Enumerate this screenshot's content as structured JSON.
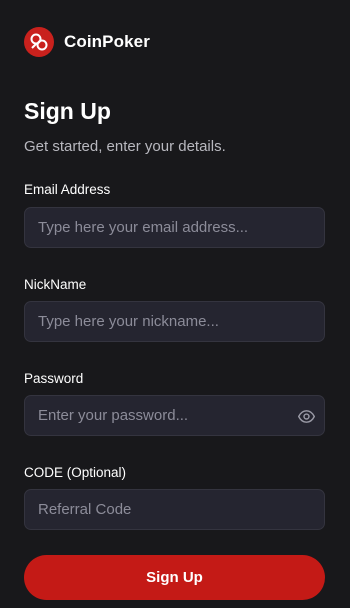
{
  "brand": {
    "name": "CoinPoker"
  },
  "form": {
    "title": "Sign Up",
    "subtitle": "Get started, enter your details.",
    "email": {
      "label": "Email Address",
      "placeholder": "Type here your email address...",
      "value": ""
    },
    "nickname": {
      "label": "NickName",
      "placeholder": "Type here your nickname...",
      "value": ""
    },
    "password": {
      "label": "Password",
      "placeholder": "Enter your password...",
      "value": ""
    },
    "code": {
      "label": "CODE (Optional)",
      "placeholder": "Referral Code",
      "value": ""
    },
    "submit_label": "Sign Up"
  },
  "icons": {
    "logo": "coinpoker-logo-icon",
    "show_password": "eye-icon"
  },
  "colors": {
    "accent": "#c41a16",
    "background": "#18181b",
    "field": "#252530"
  }
}
